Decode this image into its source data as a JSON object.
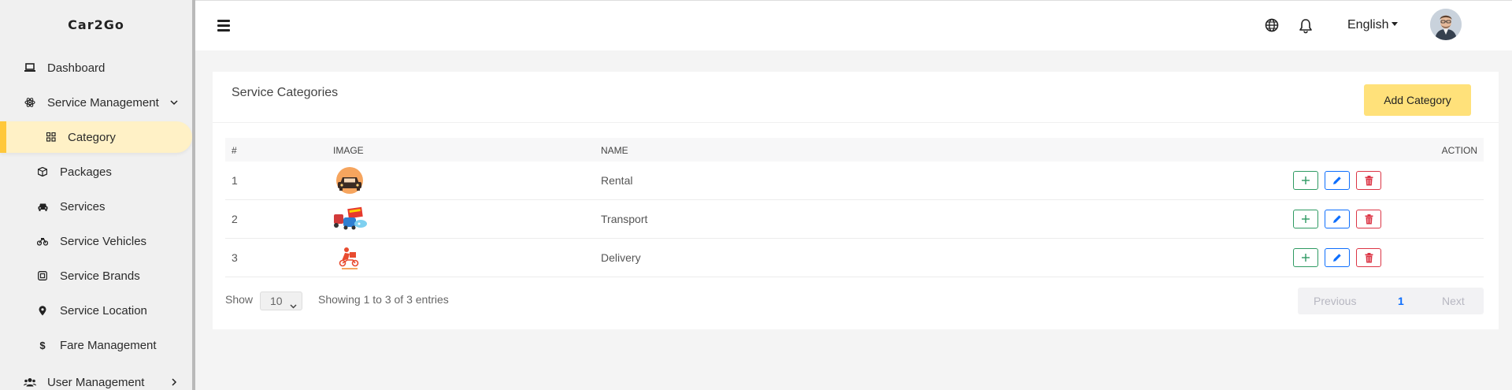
{
  "brand": "Car2Go",
  "sidebar": {
    "items": [
      {
        "label": "Dashboard",
        "icon": "laptop-icon"
      },
      {
        "label": "Service Management",
        "icon": "atom-icon",
        "expanded": true
      },
      {
        "label": "Category",
        "icon": "grid-icon",
        "active": true
      },
      {
        "label": "Packages",
        "icon": "box-icon"
      },
      {
        "label": "Services",
        "icon": "car-icon"
      },
      {
        "label": "Service Vehicles",
        "icon": "motorcycle-icon"
      },
      {
        "label": "Service Brands",
        "icon": "brand-icon"
      },
      {
        "label": "Service Location",
        "icon": "location-pin-icon"
      },
      {
        "label": "Fare Management",
        "icon": "dollar-icon"
      },
      {
        "label": "User Management",
        "icon": "users-icon",
        "expanded": false
      }
    ]
  },
  "topbar": {
    "language": "English"
  },
  "page": {
    "title": "Service Categories",
    "add_button": "Add Category"
  },
  "table": {
    "headers": [
      "#",
      "IMAGE",
      "NAME",
      "ACTION"
    ],
    "rows": [
      {
        "num": "1",
        "name": "Rental",
        "image": "rental-car-thumbnail"
      },
      {
        "num": "2",
        "name": "Transport",
        "image": "transport-thumbnail"
      },
      {
        "num": "3",
        "name": "Delivery",
        "image": "delivery-thumbnail"
      }
    ]
  },
  "footer": {
    "show_label": "Show",
    "page_size": "10",
    "entries_text": "Showing 1 to 3 of 3 entries",
    "prev": "Previous",
    "current_page": "1",
    "next": "Next"
  },
  "colors": {
    "accent": "#ffc83b",
    "active_bg": "#fff1c6",
    "add_button_bg": "#ffe17a",
    "action_add": "#2e9a62",
    "action_edit": "#0d6efd",
    "action_delete": "#dc3545"
  }
}
